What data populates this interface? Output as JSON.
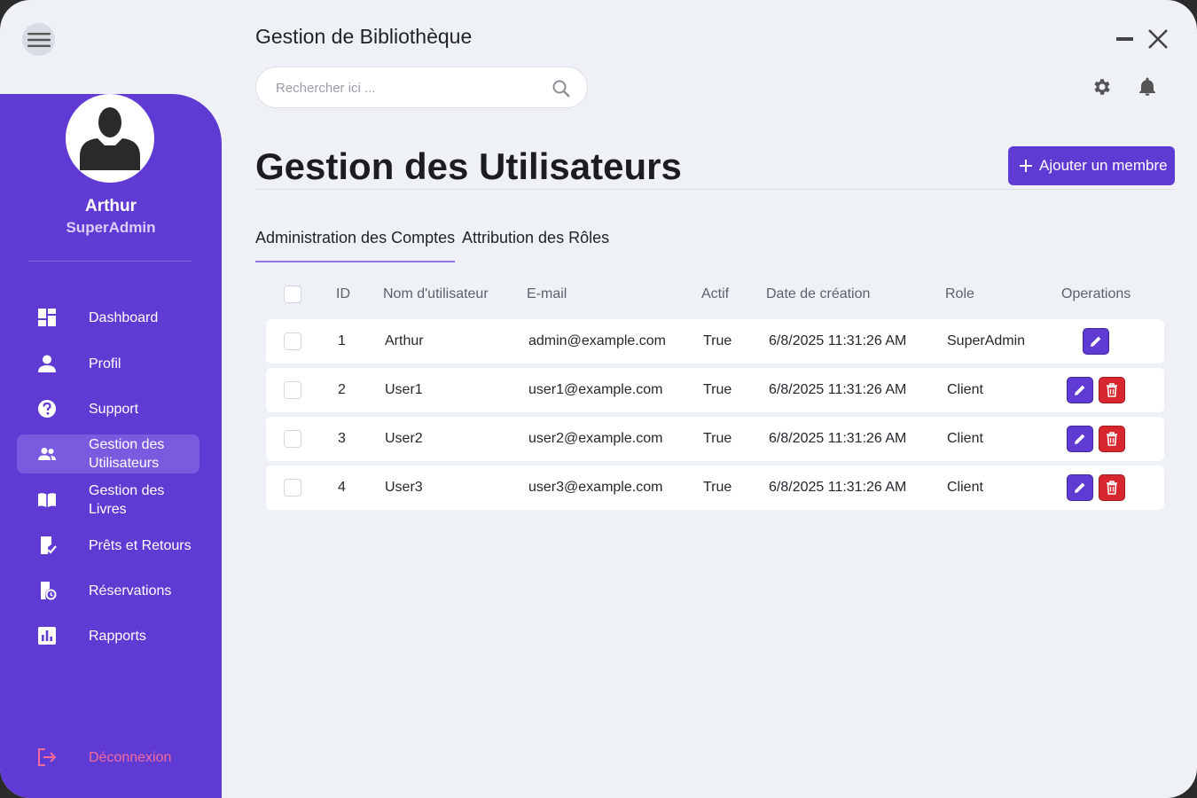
{
  "app": {
    "title": "Gestion de Bibliothèque"
  },
  "search": {
    "placeholder": "Rechercher ici ..."
  },
  "user": {
    "name": "Arthur",
    "role": "SuperAdmin"
  },
  "sidebar": {
    "items": [
      {
        "label": "Dashboard",
        "icon": "dashboard-icon"
      },
      {
        "label": "Profil",
        "icon": "person-icon"
      },
      {
        "label": "Support",
        "icon": "help-icon"
      },
      {
        "label": "Gestion des Utilisateurs",
        "icon": "users-icon",
        "active": true
      },
      {
        "label": "Gestion des Livres",
        "icon": "book-icon"
      },
      {
        "label": "Prêts et Retours",
        "icon": "loan-icon"
      },
      {
        "label": "Réservations",
        "icon": "reservation-icon"
      },
      {
        "label": "Rapports",
        "icon": "report-icon"
      }
    ],
    "logout": {
      "label": "Déconnexion",
      "icon": "logout-icon"
    }
  },
  "page": {
    "title": "Gestion des Utilisateurs",
    "add_button": "Ajouter un membre"
  },
  "tabs": [
    "Administration des Comptes",
    "Attribution des Rôles"
  ],
  "table": {
    "headers": [
      "ID",
      "Nom d'utilisateur",
      "E-mail",
      "Actif",
      "Date de création",
      "Role",
      "Operations"
    ],
    "rows": [
      {
        "id": "1",
        "username": "Arthur",
        "email": "admin@example.com",
        "active": "True",
        "created": "6/8/2025 11:31:26 AM",
        "role": "SuperAdmin",
        "ops": [
          "edit"
        ]
      },
      {
        "id": "2",
        "username": "User1",
        "email": "user1@example.com",
        "active": "True",
        "created": "6/8/2025 11:31:26 AM",
        "role": "Client",
        "ops": [
          "edit",
          "delete"
        ]
      },
      {
        "id": "3",
        "username": "User2",
        "email": "user2@example.com",
        "active": "True",
        "created": "6/8/2025 11:31:26 AM",
        "role": "Client",
        "ops": [
          "edit",
          "delete"
        ]
      },
      {
        "id": "4",
        "username": "User3",
        "email": "user3@example.com",
        "active": "True",
        "created": "6/8/2025 11:31:26 AM",
        "role": "Client",
        "ops": [
          "edit",
          "delete"
        ]
      }
    ]
  },
  "colors": {
    "accent": "#5f3bd4",
    "danger": "#d8262e",
    "background": "#eef1f6",
    "logout": "#f26b9c"
  }
}
